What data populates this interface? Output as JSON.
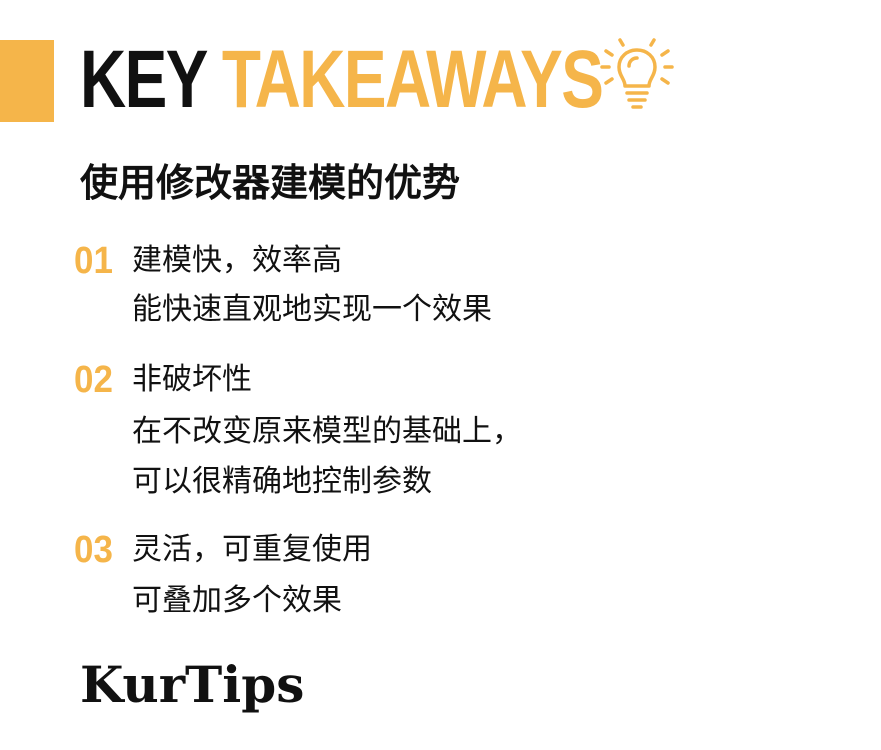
{
  "header": {
    "title_part1": "KEY",
    "title_part2": "TAKEAWAYS",
    "icon": "lightbulb-icon"
  },
  "subtitle": "使用修改器建模的优势",
  "items": [
    {
      "number": "01",
      "title": "建模快，效率高",
      "lines": [
        "能快速直观地实现一个效果"
      ]
    },
    {
      "number": "02",
      "title": "非破坏性",
      "lines": [
        "在不改变原来模型的基础上，",
        "可以很精确地控制参数"
      ]
    },
    {
      "number": "03",
      "title": "灵活，可重复使用",
      "lines": [
        "可叠加多个效果"
      ]
    }
  ],
  "footer": {
    "brand": "KurTips"
  },
  "colors": {
    "accent": "#F5B54A",
    "text": "#111111",
    "background": "#FFFFFF"
  }
}
